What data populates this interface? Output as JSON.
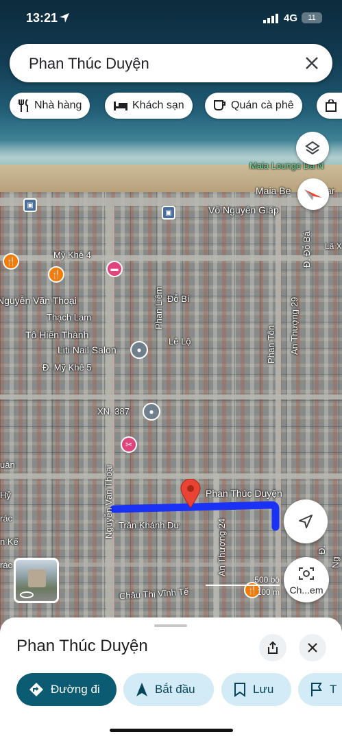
{
  "status": {
    "time": "13:21",
    "network": "4G",
    "battery": "11"
  },
  "search": {
    "query": "Phan Thúc Duyện"
  },
  "chips": [
    {
      "icon": "restaurant-icon",
      "label": "Nhà hàng"
    },
    {
      "icon": "hotel-icon",
      "label": "Khách sạn"
    },
    {
      "icon": "cafe-icon",
      "label": "Quán cà phê"
    }
  ],
  "map": {
    "labels": {
      "maia_lounge": "Maia Lounge Da N",
      "maia_beach": "Maia Be",
      "maia_beach_tail": "ar",
      "vo_nguyen_giap": "Võ Nguyên Giáp",
      "do_ba": "Đ. Đỗ Bá",
      "my_khe_4": "Mỹ Khê 4",
      "nguyen_van_thoai_top": "Nguyễn Văn Thoại",
      "thach_lam": "Thạch Lam",
      "to_hien_thanh": "Tô Hiến Thành",
      "liti_nail": "Liti Nail Salon",
      "my_khe_5": "Đ. Mỹ Khê 5",
      "phan_liem": "Phan Liêm",
      "do_bi": "Đỗ Bí",
      "le_lo": "Lê Lộ",
      "phan_ton": "Phan Tôn",
      "an_thuong_29": "An Thượng 29",
      "la_x": "Lã X",
      "xn_387": "XN. 387",
      "nguyen_van_thoai_side": "Nguyễn Văn Thoại",
      "phan_thuc_duyen": "Phan Thúc Duyện",
      "tran_khanh_du": "Trần Khánh Dư",
      "an_thuong_24": "An Thượng 24",
      "chau_thi_vinh_te": "Châu Thị Vĩnh Tế",
      "nguyen_van_thoai_bottom": "Nguyễn Văn Thoại",
      "left_uan": "uân",
      "left_hy": "Hỷ",
      "left_rac": "rác",
      "left_n_ke": "n Kế",
      "left_rac2": "rác",
      "right_d": "Đ.",
      "right_ng": "Ng"
    },
    "scale": {
      "imperial": "500 bộ",
      "metric": "100 m"
    },
    "chip_explore": "Ch...em",
    "colors": {
      "route": "#1a32f5",
      "pin": "#ea4335",
      "restaurant": "#f57c00",
      "hotel": "#e0447d",
      "shop": "#e0447d"
    }
  },
  "sheet": {
    "title": "Phan Thúc Duyện",
    "buttons": {
      "directions": "Đường đi",
      "start": "Bắt đầu",
      "save": "Lưu",
      "more": "T"
    }
  }
}
